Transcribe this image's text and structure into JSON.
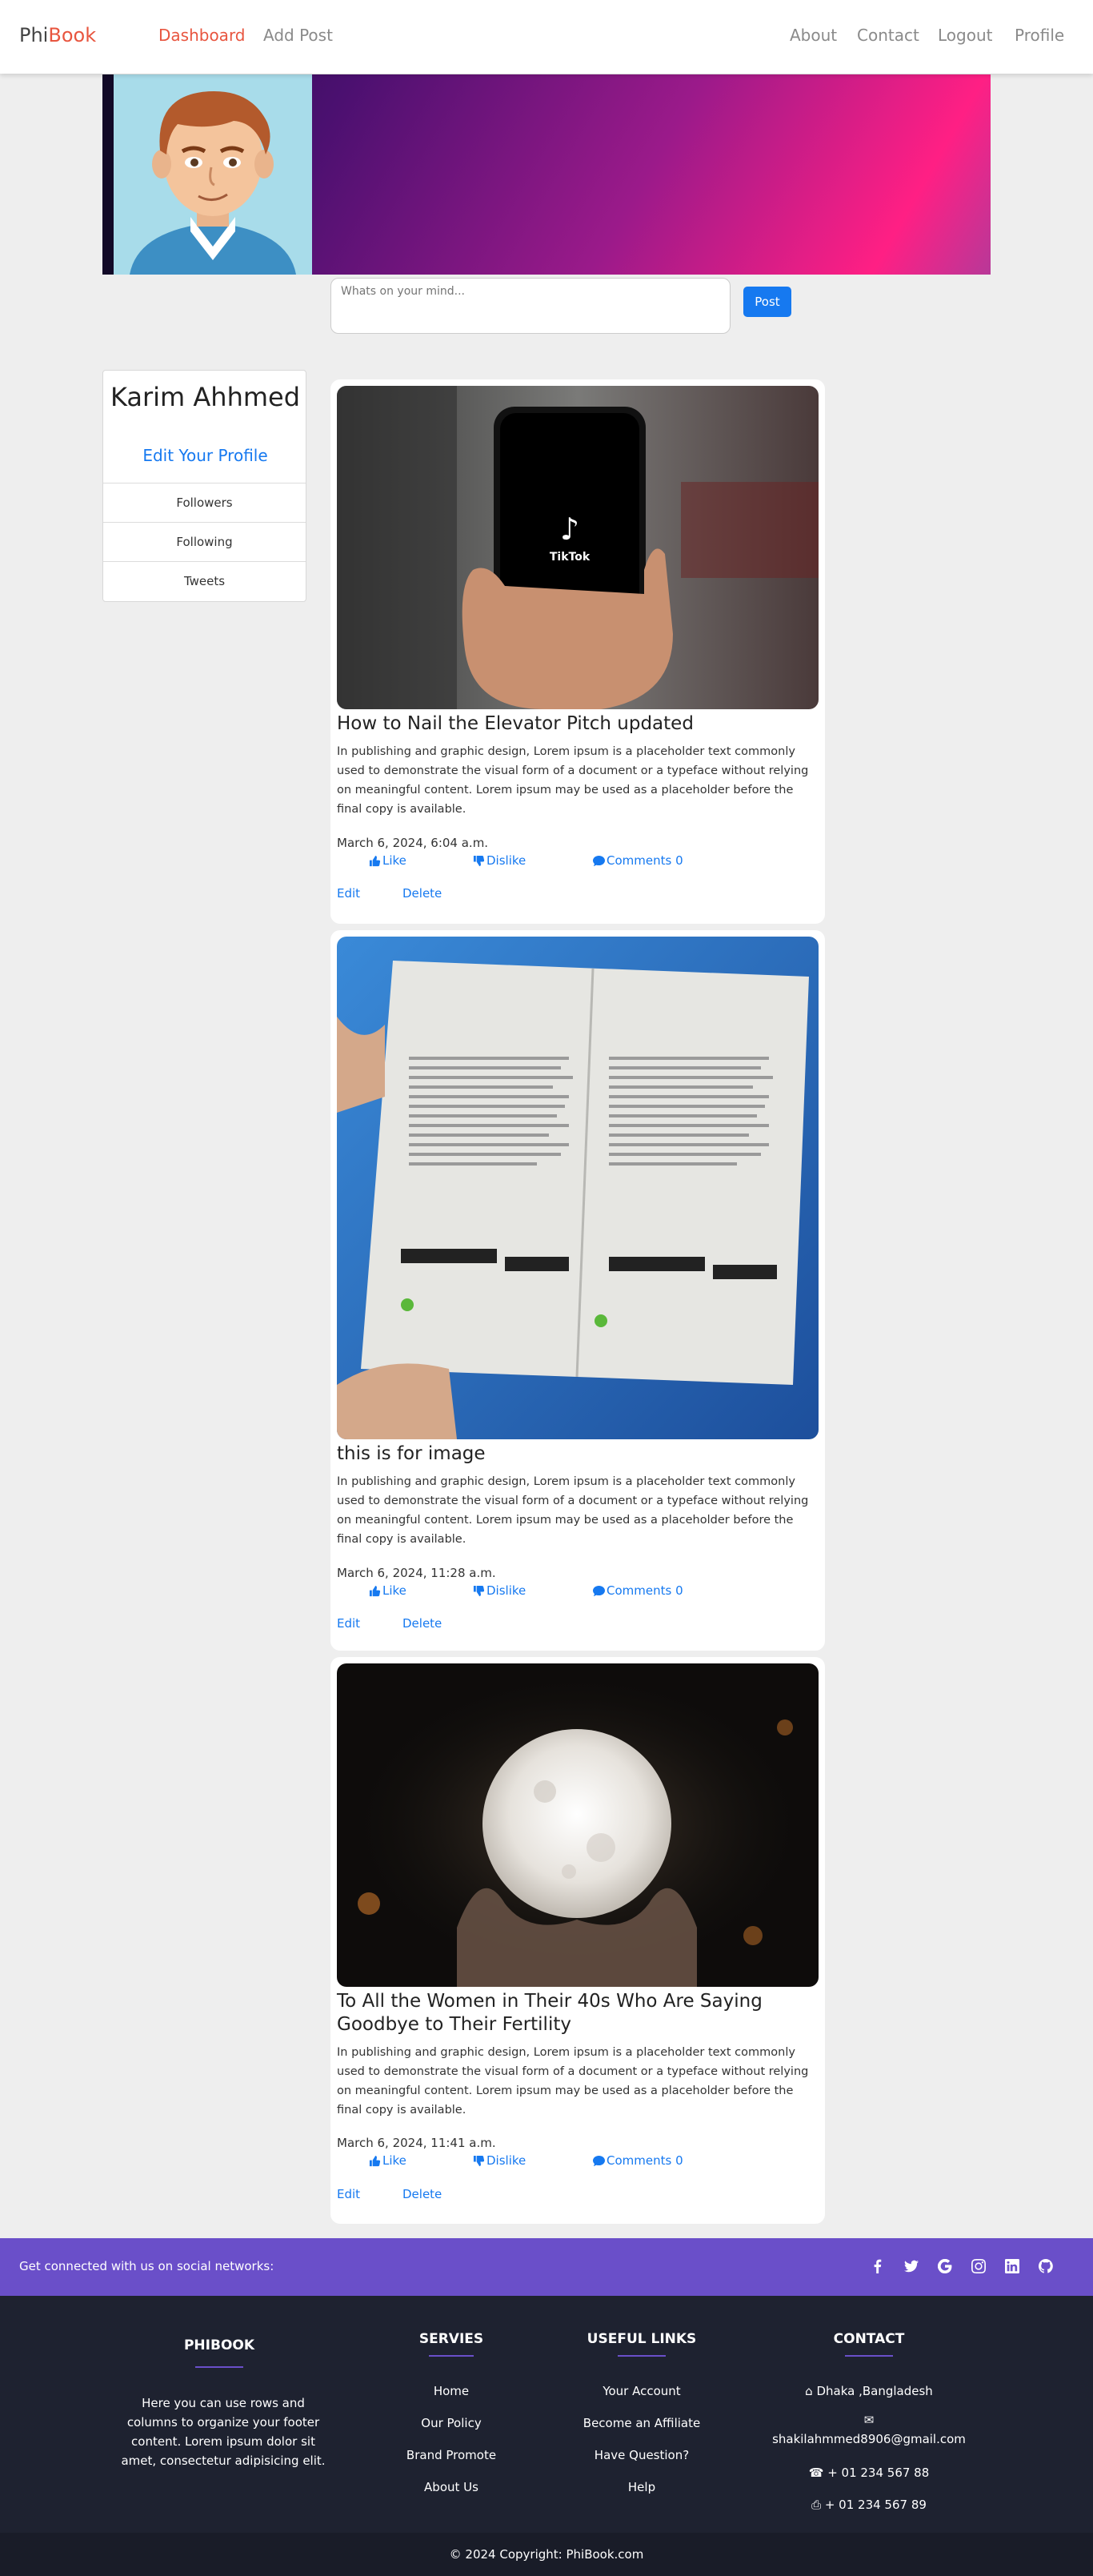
{
  "nav": {
    "brand_part1": "Phi",
    "brand_part2": "Book",
    "left_links": [
      "Dashboard",
      "Add Post"
    ],
    "right_links": [
      "About",
      "Contact",
      "Logout",
      "Profile"
    ]
  },
  "post_form": {
    "placeholder": "Whats on your mind...",
    "button_label": "Post"
  },
  "profile": {
    "name": "Karim Ahhmed",
    "edit_label": "Edit Your Profile",
    "items": [
      "Followers",
      "Following",
      "Tweets"
    ]
  },
  "posts": [
    {
      "image_icon": "phone-tiktok-photo",
      "title": "How to Nail the Elevator Pitch updated",
      "body": "In publishing and graphic design, Lorem ipsum is a placeholder text commonly used to demonstrate the visual form of a document or a typeface without relying on meaningful content. Lorem ipsum may be used as a placeholder before the final copy is available.",
      "date": "March 6, 2024, 6:04 a.m.",
      "like_label": "Like",
      "dislike_label": "Dislike",
      "comments_label": "Comments 0",
      "edit_label": "Edit",
      "delete_label": "Delete"
    },
    {
      "image_icon": "product-boxes-photo",
      "title": "this is for image",
      "body": "In publishing and graphic design, Lorem ipsum is a placeholder text commonly used to demonstrate the visual form of a document or a typeface without relying on meaningful content. Lorem ipsum may be used as a placeholder before the final copy is available.",
      "date": "March 6, 2024, 11:28 a.m.",
      "like_label": "Like",
      "dislike_label": "Dislike",
      "comments_label": "Comments 0",
      "edit_label": "Edit",
      "delete_label": "Delete"
    },
    {
      "image_icon": "glowing-moon-lamp-photo",
      "title": "To All the Women in Their 40s Who Are Saying Goodbye to Their Fertility",
      "body": "In publishing and graphic design, Lorem ipsum is a placeholder text commonly used to demonstrate the visual form of a document or a typeface without relying on meaningful content. Lorem ipsum may be used as a placeholder before the final copy is available.",
      "date": "March 6, 2024, 11:41 a.m.",
      "like_label": "Like",
      "dislike_label": "Dislike",
      "comments_label": "Comments 0",
      "edit_label": "Edit",
      "delete_label": "Delete"
    }
  ],
  "social_bar": {
    "text": "Get connected with us on social networks:",
    "icons": [
      "facebook-icon",
      "twitter-icon",
      "google-icon",
      "instagram-icon",
      "linkedin-icon",
      "github-icon"
    ],
    "color": "#6a4fc9"
  },
  "footer": {
    "about": {
      "heading": "PHIBOOK",
      "text": "Here you can use rows and columns to organize your footer content. Lorem ipsum dolor sit amet, consectetur adipisicing elit."
    },
    "services": {
      "heading": "SERVIES",
      "links": [
        "Home",
        "Our Policy",
        "Brand Promote",
        "About Us"
      ]
    },
    "useful": {
      "heading": "USEFUL LINKS",
      "links": [
        "Your Account",
        "Become an Affiliate",
        "Have Question?",
        "Help"
      ]
    },
    "contact": {
      "heading": "CONTACT",
      "address": "Dhaka ,Bangladesh",
      "email": "shakilahmmed8906@gmail.com",
      "phone": "+ 01 234 567 88",
      "fax": "+ 01 234 567 89"
    }
  },
  "copyright": "© 2024 Copyright: PhiBook.com",
  "colors": {
    "brand_accent": "#e8553f",
    "link_blue": "#1679f0",
    "footer_bg": "#1e2230"
  }
}
